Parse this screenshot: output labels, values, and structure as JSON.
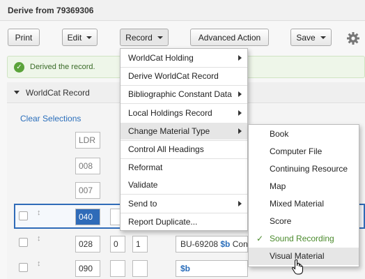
{
  "page": {
    "title": "Derive from 79369306"
  },
  "toolbar": {
    "print_label": "Print",
    "edit_label": "Edit",
    "record_label": "Record",
    "advanced_label": "Advanced Action",
    "save_label": "Save"
  },
  "alert": {
    "message": "Derived the record."
  },
  "section": {
    "label": "WorldCat Record"
  },
  "editor": {
    "clear_label": "Clear Selections",
    "tags": [
      "LDR",
      "008",
      "007",
      "040",
      "028",
      "090"
    ],
    "ind_028": [
      "0",
      "1"
    ],
    "content_028": {
      "value": "BU-69208 ",
      "sub": "$b",
      "rest": " Con"
    },
    "content_090": {
      "sub": "$b"
    }
  },
  "record_menu": {
    "items": [
      {
        "label": "WorldCat Holding",
        "submenu": true
      },
      {
        "label": "Derive WorldCat Record",
        "submenu": false
      },
      {
        "label": "Bibliographic Constant Data",
        "submenu": true
      },
      {
        "label": "Local Holdings Record",
        "submenu": true
      },
      {
        "label": "Change Material Type",
        "submenu": true,
        "highlighted": true
      },
      {
        "label": "Control All Headings",
        "submenu": false
      },
      {
        "label": "Reformat",
        "submenu": false
      },
      {
        "label": "Validate",
        "submenu": false
      },
      {
        "label": "Send to",
        "submenu": true
      },
      {
        "label": "Report Duplicate...",
        "submenu": false
      }
    ]
  },
  "material_menu": {
    "items": [
      {
        "label": "Book",
        "checked": false
      },
      {
        "label": "Computer File",
        "checked": false
      },
      {
        "label": "Continuing Resource",
        "checked": false
      },
      {
        "label": "Map",
        "checked": false
      },
      {
        "label": "Mixed Material",
        "checked": false
      },
      {
        "label": "Score",
        "checked": false
      },
      {
        "label": "Sound Recording",
        "checked": true
      },
      {
        "label": "Visual Material",
        "checked": false,
        "hover": true
      }
    ],
    "check_glyph": "✓"
  },
  "colors": {
    "accent": "#2f6bb8",
    "link": "#2a6ebb",
    "success": "#5aa33a"
  },
  "icons": [
    "gear-icon",
    "check-circle-icon",
    "chevron-right-icon",
    "drag-handle-icon",
    "hand-cursor-icon"
  ]
}
